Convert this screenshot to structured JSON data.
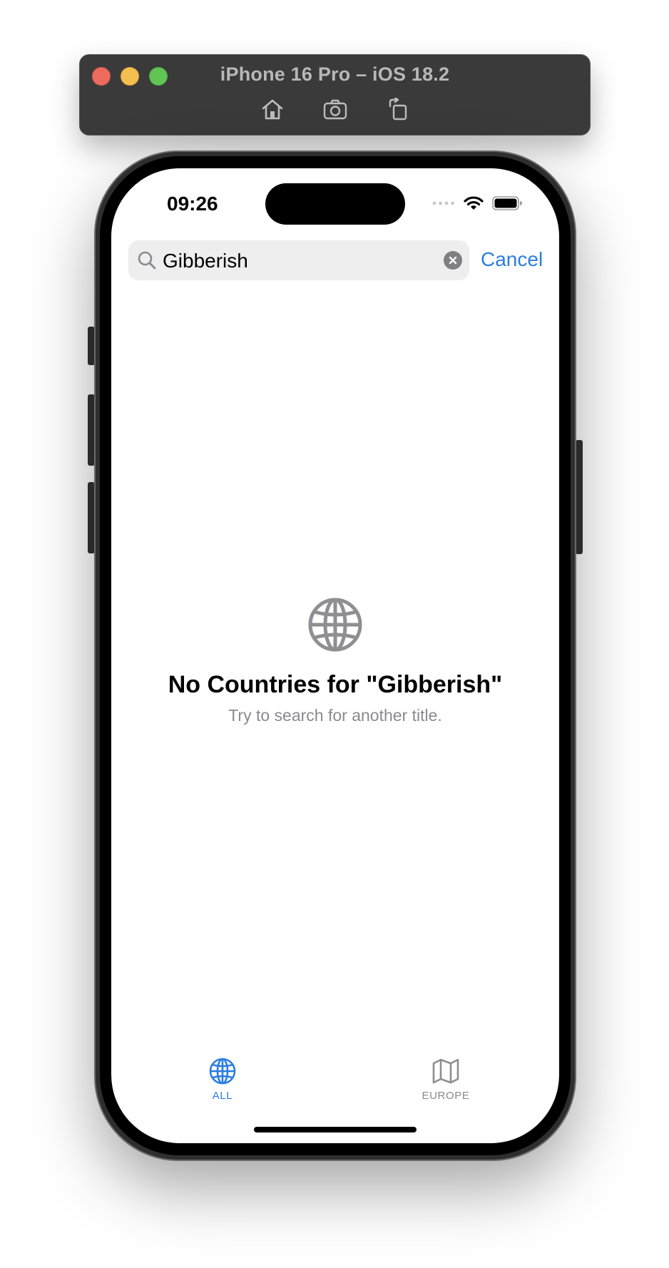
{
  "simulator": {
    "title": "iPhone 16 Pro – iOS 18.2",
    "tools": [
      {
        "name": "home",
        "icon": "home-icon"
      },
      {
        "name": "screenshot",
        "icon": "camera-icon"
      },
      {
        "name": "rotate",
        "icon": "rotate-icon"
      }
    ]
  },
  "status_bar": {
    "time": "09:26"
  },
  "search": {
    "query": "Gibberish",
    "cancel_label": "Cancel"
  },
  "empty_state": {
    "icon": "globe-icon",
    "title": "No Countries for \"Gibberish\"",
    "subtitle": "Try to search for another title."
  },
  "tab_bar": {
    "tabs": [
      {
        "label": "ALL",
        "icon": "globe-icon",
        "selected": true
      },
      {
        "label": "EUROPE",
        "icon": "map-icon",
        "selected": false
      }
    ]
  },
  "colors": {
    "accent": "#2b7de2",
    "secondary_text": "#8a8a8e",
    "search_field_bg": "#eeeeef"
  }
}
